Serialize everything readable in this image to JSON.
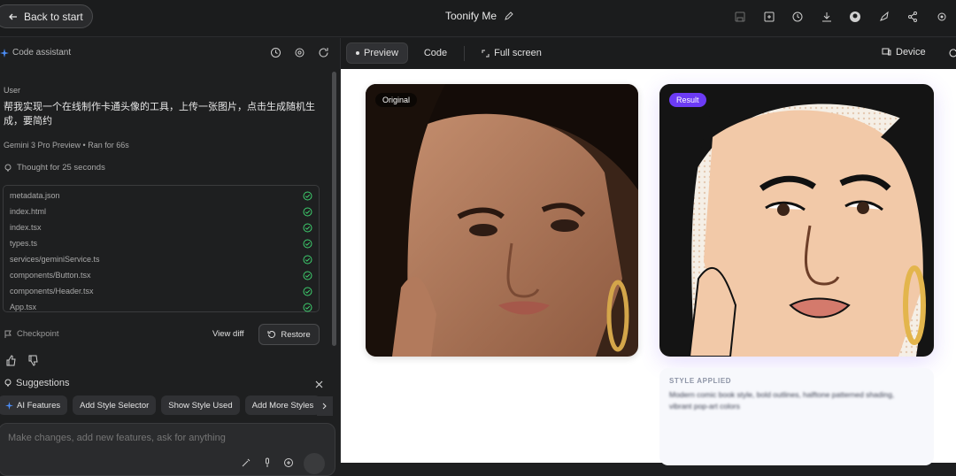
{
  "header": {
    "back_label": "Back to start",
    "title": "Toonify Me",
    "icons": [
      "save-icon",
      "preview-icon",
      "history-icon",
      "download-icon",
      "github-icon",
      "deploy-icon",
      "share-icon",
      "settings-icon"
    ]
  },
  "assistant": {
    "title": "Code assistant",
    "user_label": "User",
    "user_message": "帮我实现一个在线制作卡通头像的工具，上传一张图片，点击生成随机生成，要简约",
    "model": "Gemini 3 Pro Preview",
    "run_time": "Ran for 66s",
    "thought": "Thought for 25 seconds",
    "files": [
      "metadata.json",
      "index.html",
      "index.tsx",
      "types.ts",
      "services/geminiService.ts",
      "components/Button.tsx",
      "components/Header.tsx",
      "App.tsx"
    ],
    "checkpoint_label": "Checkpoint",
    "view_diff_label": "View diff",
    "restore_label": "Restore",
    "suggestions_title": "Suggestions",
    "suggestions": [
      "AI Features",
      "Add Style Selector",
      "Show Style Used",
      "Add More Styles"
    ],
    "composer_placeholder": "Make changes, add new features, ask for anything"
  },
  "preview": {
    "tabs": [
      "Preview",
      "Code",
      "Full screen"
    ],
    "device_label": "Device",
    "original_badge": "Original",
    "result_badge": "Result",
    "style_label": "STYLE APPLIED",
    "style_text": "Modern comic book style, bold outlines, halftone patterned shading, vibrant pop-art colors",
    "colors": {
      "accent": "#6c3bf5",
      "success": "#3ecf6e",
      "dark_bg": "#1e1f20"
    }
  }
}
